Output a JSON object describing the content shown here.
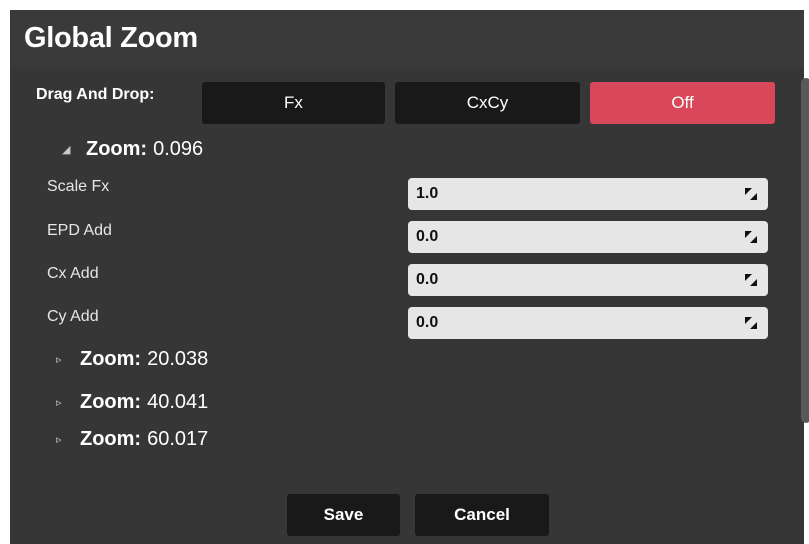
{
  "dialog": {
    "title": "Global Zoom"
  },
  "drag_and_drop": {
    "label": "Drag And Drop:",
    "options": [
      "Fx",
      "CxCy",
      "Off"
    ],
    "selected": "Off",
    "accent_color": "#d9475a"
  },
  "expanded_group": {
    "key": "Zoom:",
    "value": "0.096",
    "properties": [
      {
        "label": "Scale Fx",
        "value": "1.0"
      },
      {
        "label": "EPD Add",
        "value": "0.0"
      },
      {
        "label": "Cx Add",
        "value": "0.0"
      },
      {
        "label": "Cy Add",
        "value": "0.0"
      }
    ]
  },
  "collapsed_groups": [
    {
      "key": "Zoom:",
      "value": "20.038"
    },
    {
      "key": "Zoom:",
      "value": "40.041"
    },
    {
      "key": "Zoom:",
      "value": "60.017"
    }
  ],
  "buttons": {
    "save": "Save",
    "cancel": "Cancel"
  }
}
